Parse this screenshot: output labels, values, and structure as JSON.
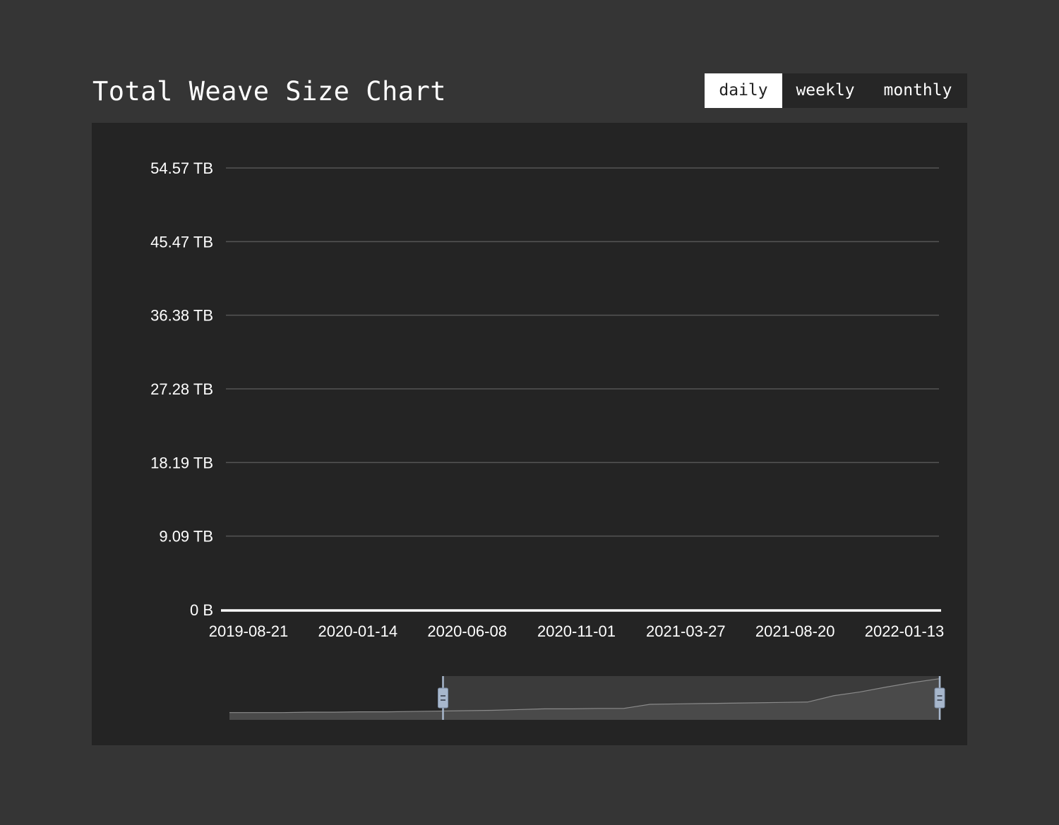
{
  "header": {
    "title": "Total Weave Size Chart",
    "tabs": [
      {
        "label": "daily",
        "active": true
      },
      {
        "label": "weekly",
        "active": false
      },
      {
        "label": "monthly",
        "active": false
      }
    ]
  },
  "colors": {
    "page_bg": "#353535",
    "panel_bg": "#242424",
    "text": "#ffffff",
    "grid": "#555555",
    "zoom_handle": "#a7b7cc"
  },
  "chart_data": {
    "type": "area",
    "ylabel": "",
    "xlabel": "",
    "y_tick_labels": [
      "0 B",
      "9.09 TB",
      "18.19 TB",
      "27.28 TB",
      "36.38 TB",
      "45.47 TB",
      "54.57 TB"
    ],
    "x_tick_labels": [
      "2019-08-21",
      "2020-01-14",
      "2020-06-08",
      "2020-11-01",
      "2021-03-27",
      "2021-08-20",
      "2022-01-13"
    ],
    "ylim_tb": [
      0,
      54.57
    ],
    "grid": true,
    "main_series": {
      "name": "",
      "description_values": "values in main plot rounded to near 0 at this scale",
      "points": [
        {
          "date": "2019-08-21",
          "tb": 0
        },
        {
          "date": "2022-01-13",
          "tb": 0
        }
      ]
    },
    "zoom_overview": {
      "range_start_fraction": 0.3,
      "range_end_fraction": 1.0,
      "series": [
        0.1,
        0.1,
        0.1,
        0.11,
        0.11,
        0.12,
        0.12,
        0.13,
        0.14,
        0.15,
        0.16,
        0.18,
        0.2,
        0.2,
        0.21,
        0.21,
        0.32,
        0.33,
        0.34,
        0.35,
        0.36,
        0.37,
        0.38,
        0.55,
        0.65,
        0.78,
        0.9,
        1.0
      ]
    }
  }
}
